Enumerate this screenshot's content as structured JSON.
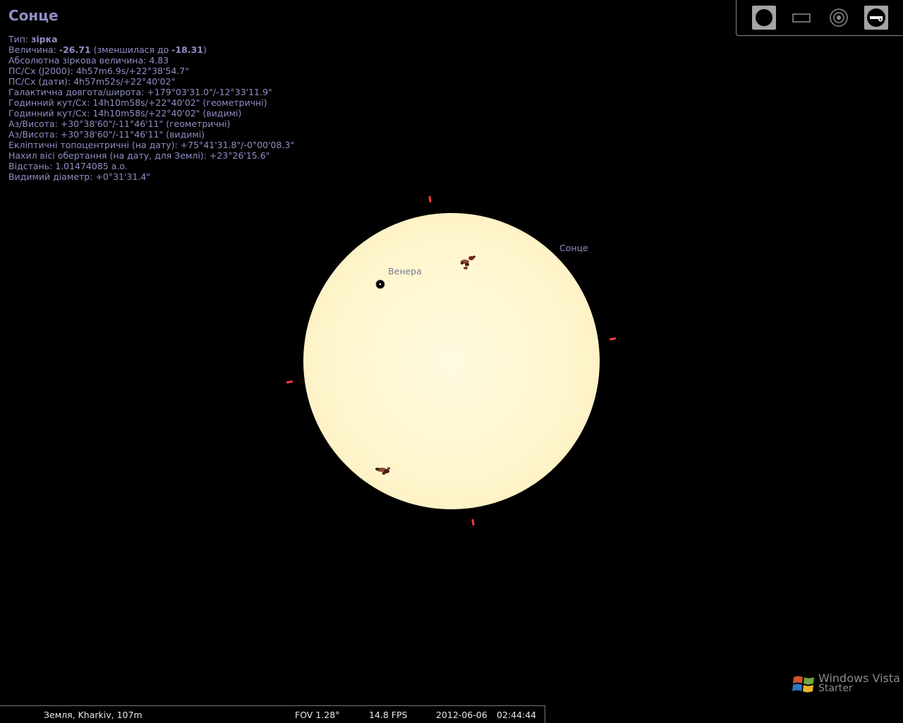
{
  "object": {
    "name": "Сонце",
    "lines": [
      [
        {
          "t": "Тип: "
        },
        {
          "t": "зірка",
          "b": true
        }
      ],
      [
        {
          "t": "Величина: "
        },
        {
          "t": "-26.71",
          "b": true
        },
        {
          "t": " (зменшилася до "
        },
        {
          "t": "-18.31",
          "b": true
        },
        {
          "t": ")"
        }
      ],
      [
        {
          "t": "Абсолютна зіркова величина: 4.83"
        }
      ],
      [
        {
          "t": "ПС/Сх (J2000): 4h57m6.9s/+22°38'54.7\""
        }
      ],
      [
        {
          "t": "ПС/Сх (дати): 4h57m52s/+22°40'02\""
        }
      ],
      [
        {
          "t": "Галактична довгота/широта: +179°03'31.0\"/-12°33'11.9\""
        }
      ],
      [
        {
          "t": "Годинний кут/Сх: 14h10m58s/+22°40'02\" (геометричні)"
        }
      ],
      [
        {
          "t": "Годинний кут/Сх: 14h10m58s/+22°40'02\" (видимі)"
        }
      ],
      [
        {
          "t": "Аз/Висота: +30°38'60\"/-11°46'11\" (геометричні)"
        }
      ],
      [
        {
          "t": "Аз/Висота: +30°38'60\"/-11°46'11\" (видимі)"
        }
      ],
      [
        {
          "t": "Екліптичні топоцентричні (на дату): +75°41'31.8\"/-0°00'08.3\""
        }
      ],
      [
        {
          "t": "Нахил вісі обертання (на дату, для Землі): +23°26'15.6\""
        }
      ],
      [
        {
          "t": "Відстань: 1.01474085 а.о."
        }
      ],
      [
        {
          "t": "Видимий діаметр: +0°31'31.4\""
        }
      ]
    ]
  },
  "sky": {
    "sun_label": "Сонце",
    "venus_label": "Венера"
  },
  "toolbar": {
    "buttons": [
      {
        "name": "full-disk-button",
        "icon": "filled-circle-icon",
        "active": true
      },
      {
        "name": "frame-button",
        "icon": "rectangle-icon",
        "active": false
      },
      {
        "name": "target-button",
        "icon": "target-icon",
        "active": false
      },
      {
        "name": "telescope-button",
        "icon": "telescope-icon",
        "active": true
      }
    ]
  },
  "status": {
    "location": "Земля, Kharkiv, 107m",
    "fov": "FOV 1.28°",
    "fps": "14.8 FPS",
    "date": "2012-06-06",
    "time": "02:44:44"
  },
  "watermark": {
    "line1": "Windows Vista",
    "line2": "Starter"
  },
  "colors": {
    "info_text": "#8f8fc6",
    "tick_marks": "#ff3a3a",
    "sun_disk": "#fff6ce"
  }
}
